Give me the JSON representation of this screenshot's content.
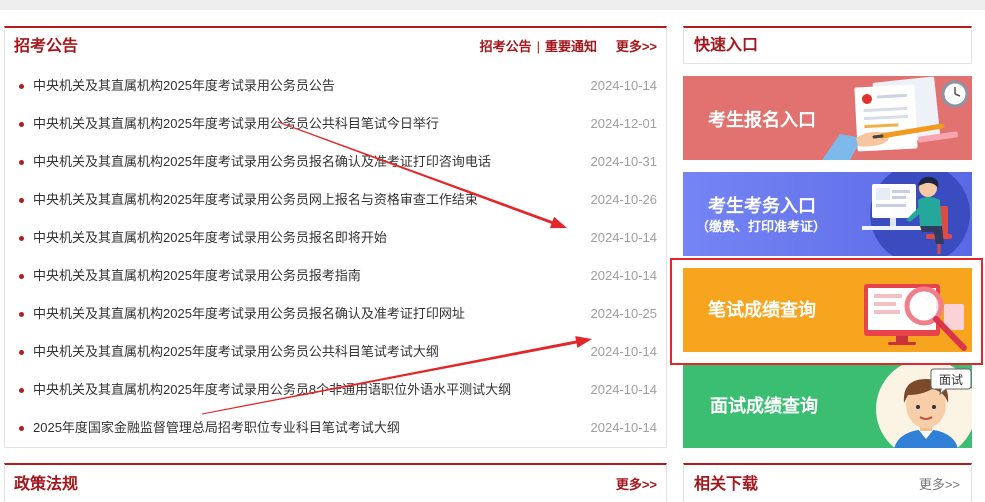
{
  "colors": {
    "accent": "#b71c1c",
    "title_text": "#a3181e",
    "date_text": "#a0a0a0",
    "annotation": "#e3262a"
  },
  "announcements": {
    "title": "招考公告",
    "tabs": [
      "招考公告",
      "重要通知"
    ],
    "tab_separator": "|",
    "more": "更多>>",
    "items": [
      {
        "title": "中央机关及其直属机构2025年度考试录用公务员公告",
        "date": "2024-10-14"
      },
      {
        "title": "中央机关及其直属机构2025年度考试录用公务员公共科目笔试今日举行",
        "date": "2024-12-01"
      },
      {
        "title": "中央机关及其直属机构2025年度考试录用公务员报名确认及准考证打印咨询电话",
        "date": "2024-10-31"
      },
      {
        "title": "中央机关及其直属机构2025年度考试录用公务员网上报名与资格审查工作结束",
        "date": "2024-10-26"
      },
      {
        "title": "中央机关及其直属机构2025年度考试录用公务员报名即将开始",
        "date": "2024-10-14"
      },
      {
        "title": "中央机关及其直属机构2025年度考试录用公务员报考指南",
        "date": "2024-10-14"
      },
      {
        "title": "中央机关及其直属机构2025年度考试录用公务员报名确认及准考证打印网址",
        "date": "2024-10-25"
      },
      {
        "title": "中央机关及其直属机构2025年度考试录用公务员公共科目笔试考试大纲",
        "date": "2024-10-14"
      },
      {
        "title": "中央机关及其直属机构2025年度考试录用公务员8个非通用语职位外语水平测试大纲",
        "date": "2024-10-14"
      },
      {
        "title": "2025年度国家金融监督管理总局招考职位专业科目笔试考试大纲",
        "date": "2024-10-14"
      }
    ]
  },
  "quick_entry": {
    "title": "快速入口",
    "banners": [
      {
        "label": "考生报名入口",
        "icon": "documents-pen-icon",
        "color": "#e27270"
      },
      {
        "label": "考生考务入口",
        "sublabel": "（缴费、打印准考证）",
        "icon": "person-at-desk-icon",
        "color": "#6676ed"
      },
      {
        "label": "笔试成绩查询",
        "icon": "monitor-magnifier-icon",
        "color": "#f7a51f",
        "highlighted": true
      },
      {
        "label": "面试成绩查询",
        "bubble_text": "面试",
        "icon": "interview-face-icon",
        "color": "#3cbe72"
      }
    ]
  },
  "policy": {
    "title": "政策法规",
    "more": "更多>>"
  },
  "downloads": {
    "title": "相关下载",
    "more": "更多>>"
  }
}
